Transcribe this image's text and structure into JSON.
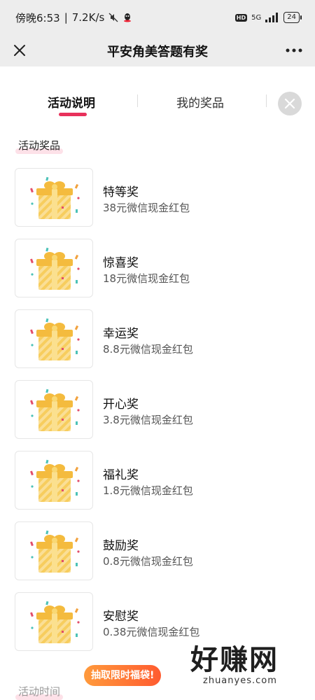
{
  "status": {
    "time": "傍晚6:53",
    "speed": "7.2K/s",
    "network": "5G",
    "battery": "24"
  },
  "header": {
    "title": "平安角美答题有奖"
  },
  "tabs": [
    {
      "label": "活动说明",
      "active": true
    },
    {
      "label": "我的奖品",
      "active": false
    }
  ],
  "sections": {
    "prizes_title": "活动奖品",
    "time_title": "活动时间"
  },
  "prizes": [
    {
      "name": "特等奖",
      "desc": "38元微信现金红包"
    },
    {
      "name": "惊喜奖",
      "desc": "18元微信现金红包"
    },
    {
      "name": "幸运奖",
      "desc": "8.8元微信现金红包"
    },
    {
      "name": "开心奖",
      "desc": "3.8元微信现金红包"
    },
    {
      "name": "福礼奖",
      "desc": "1.8元微信现金红包"
    },
    {
      "name": "鼓励奖",
      "desc": "0.8元微信现金红包"
    },
    {
      "name": "安慰奖",
      "desc": "0.38元微信现金红包"
    }
  ],
  "promo": {
    "label": "抽取限时福袋!"
  },
  "watermark": {
    "big": "好赚网",
    "small": "zhuanyes.com"
  },
  "colors": {
    "accent": "#e8315b",
    "gift": "#f6c34a"
  }
}
